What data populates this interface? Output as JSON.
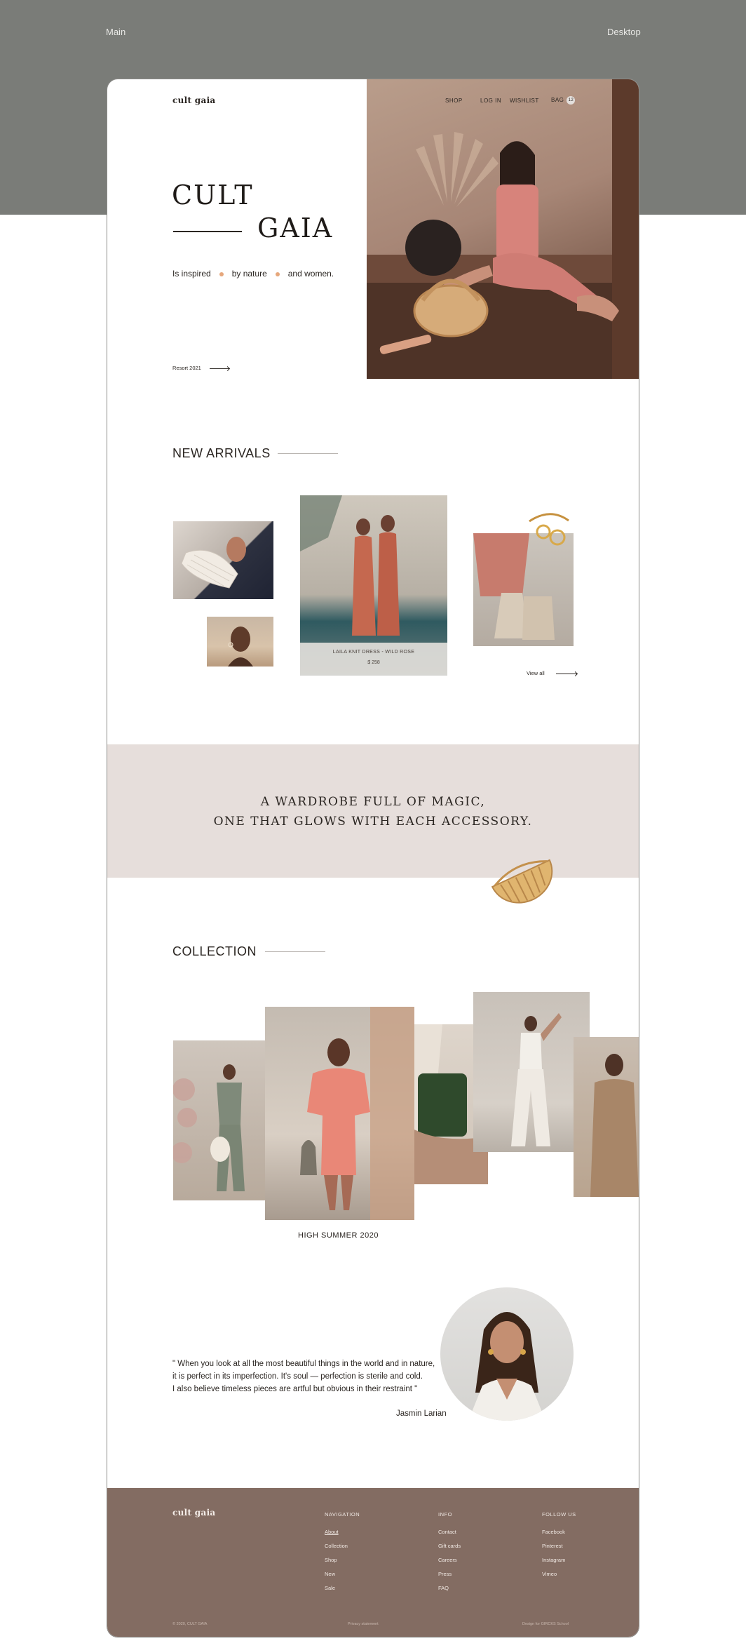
{
  "canvas": {
    "left_label": "Main",
    "right_label": "Desktop"
  },
  "brand": {
    "logo": "cult gaia"
  },
  "nav": {
    "shop": "SHOP",
    "login": "LOG IN",
    "wishlist": "WISHLIST",
    "bag": "BAG",
    "bag_count": "12"
  },
  "hero": {
    "title_line1": "CULT",
    "title_line2": "GAIA",
    "tagline_1": "Is inspired",
    "tagline_2": "by nature",
    "tagline_3": "and women.",
    "link": "Resort 2021"
  },
  "new_arrivals": {
    "title": "NEW ARRIVALS",
    "featured_name": "LAILA KNIT DRESS - WILD ROSE",
    "featured_price": "$ 258",
    "view_all": "View all"
  },
  "banner": {
    "line1": "A WARDROBE FULL OF MAGIC,",
    "line2": "ONE THAT GLOWS WITH EACH ACCESSORY."
  },
  "collection": {
    "title": "COLLECTION",
    "caption": "HIGH SUMMER 2020"
  },
  "testimonial": {
    "quote_1": "\" When you look at all the most beautiful things in the world and in nature,",
    "quote_2": "it is perfect in its imperfection. It's soul — perfection is sterile and cold.",
    "quote_3": "I also believe timeless pieces are artful but obvious in their restraint \"",
    "author": "Jasmin Larian"
  },
  "footer": {
    "logo": "cult gaia",
    "navigation": {
      "heading": "NAVIGATION",
      "items": [
        "About",
        "Collection",
        "Shop",
        "New",
        "Sale"
      ]
    },
    "info": {
      "heading": "INFO",
      "items": [
        "Contact",
        "Gift cards",
        "Careers",
        "Press",
        "FAQ"
      ]
    },
    "follow": {
      "heading": "FOLLOW US",
      "items": [
        "Facebook",
        "Pinterest",
        "Instagram",
        "Vimeo"
      ]
    },
    "copyright": "© 2020, CULT GAIA",
    "privacy": "Privacy statement",
    "credit": "Design for GIRCKS School"
  },
  "colors": {
    "accent_dot": "#e6a77c",
    "banner_bg": "#e6dedb",
    "footer_bg": "#836c62",
    "canvas_bg": "#7a7c78"
  }
}
